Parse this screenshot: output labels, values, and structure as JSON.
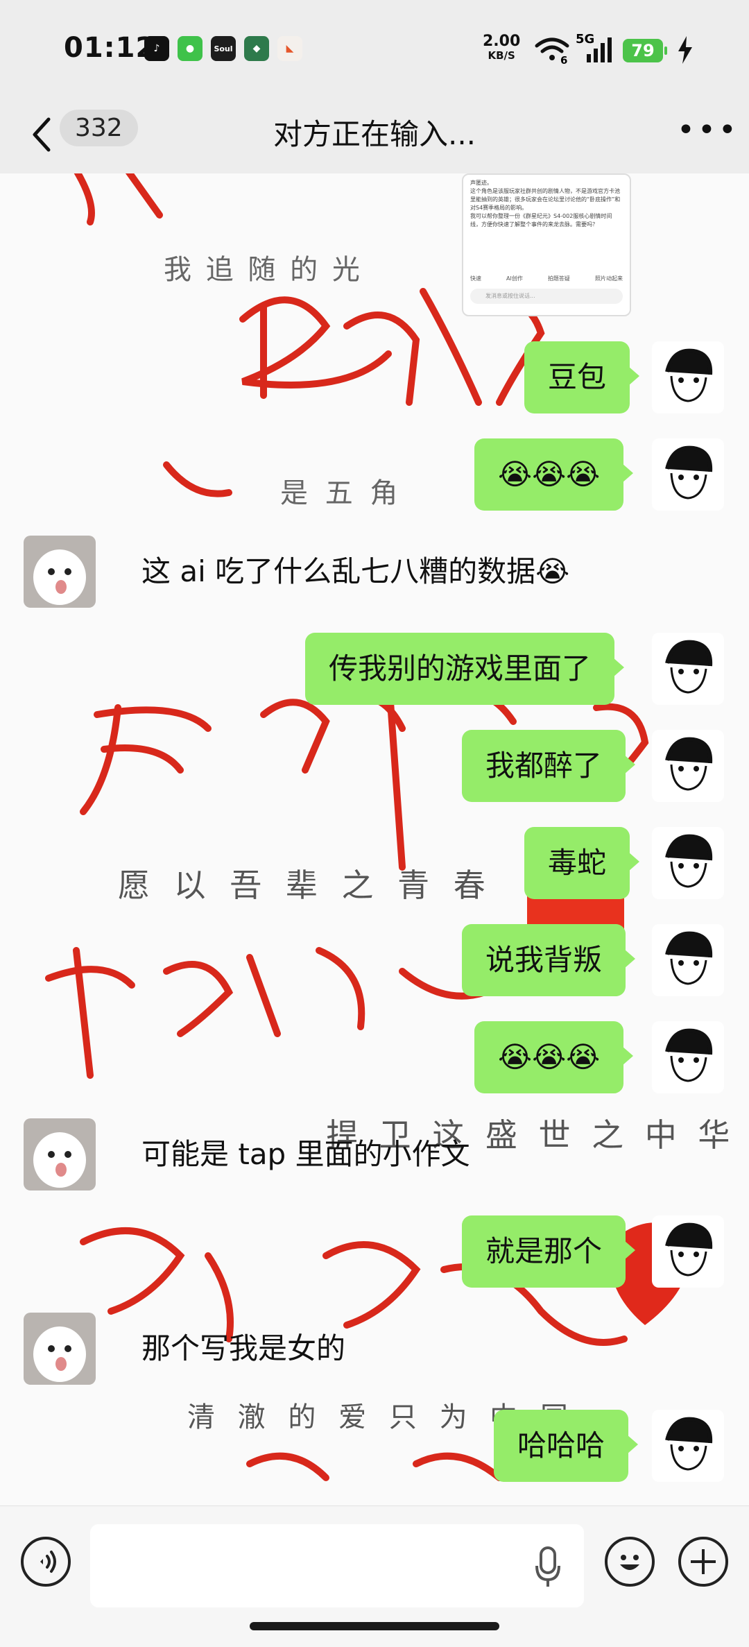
{
  "status_bar": {
    "time": "01:12",
    "net_speed_value": "2.00",
    "net_speed_unit": "KB/S",
    "network_type": "5G",
    "wifi_sub": "6",
    "battery": "79",
    "apps": [
      {
        "icon": "tiktok-icon",
        "color": "#111111",
        "label": "♪"
      },
      {
        "icon": "wechat-icon",
        "color": "#3fc24a",
        "label": "●"
      },
      {
        "icon": "soul-icon",
        "color": "#1d1d1d",
        "label": "Soul"
      },
      {
        "icon": "game-icon",
        "color": "#2e7a4b",
        "label": "◆"
      },
      {
        "icon": "mini-game-icon",
        "color": "#f4f0ec",
        "label": "◣"
      }
    ]
  },
  "header": {
    "unread_count": "332",
    "title": "对方正在输入..."
  },
  "background_art": {
    "line1": "我  追  随  的  光",
    "line2": "是  五  角",
    "line3": "愿 以 吾 辈 之 青 春",
    "line4": "捍 卫 这 盛 世 之 中 华",
    "line5": "清 澈 的 爱 只 为 中 国"
  },
  "embedded_screenshot": {
    "line_a": "声匿迹。",
    "line_b": "这个角色是该服玩家社群共创的剧情人物，不是游戏官方卡池里能抽到的英雄；很多玩家会在论坛里讨论他的“卧底操作”和对S4赛季格局的影响。",
    "line_c": "我可以帮你整理一份《群星纪元》S4-002服核心剧情时间线，方便你快速了解整个事件的来龙去脉。需要吗？",
    "actions": [
      "快速",
      "AI创作",
      "拍题答疑",
      "照片动起来"
    ],
    "input_placeholder": "发消息或按住说话..."
  },
  "messages": [
    {
      "side": "me",
      "text": "豆包"
    },
    {
      "side": "me",
      "text": "😭😭😭"
    },
    {
      "side": "them",
      "text": "这 ai 吃了什么乱七八糟的数据😭"
    },
    {
      "side": "me",
      "text": "传我别的游戏里面了"
    },
    {
      "side": "me",
      "text": "我都醉了"
    },
    {
      "side": "me",
      "text": "毒蛇"
    },
    {
      "side": "me",
      "text": "说我背叛"
    },
    {
      "side": "me",
      "text": "😭😭😭"
    },
    {
      "side": "them",
      "text": "可能是 tap 里面的小作文"
    },
    {
      "side": "me",
      "text": "就是那个"
    },
    {
      "side": "them",
      "text": "那个写我是女的"
    },
    {
      "side": "me",
      "text": "哈哈哈"
    }
  ],
  "input_bar": {
    "placeholder": ""
  },
  "colors": {
    "my_bubble": "#95ec69",
    "calligraphy_red": "#d8281b",
    "header_bg": "#ededed"
  }
}
